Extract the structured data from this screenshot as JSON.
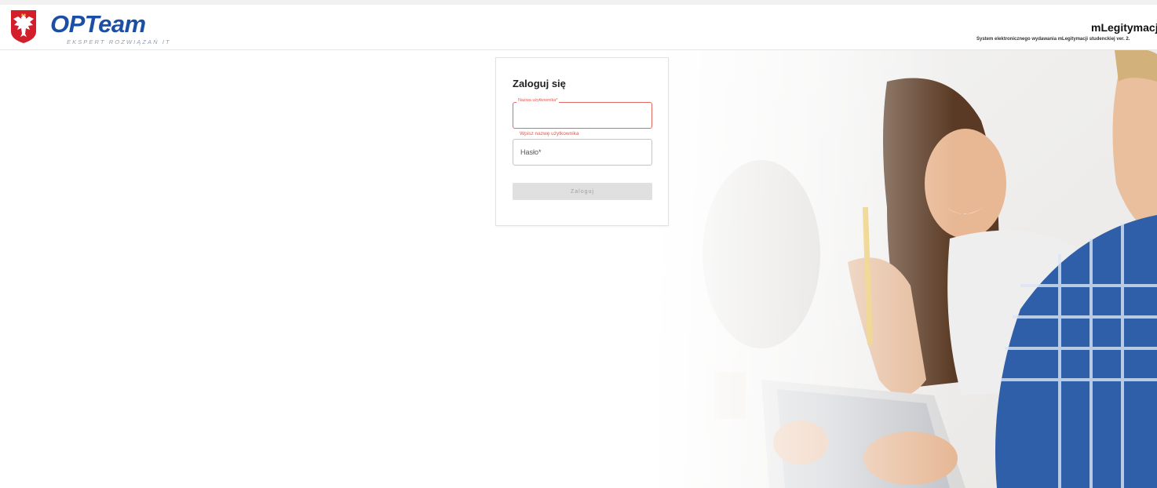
{
  "header": {
    "brand_name": "OPTeam",
    "brand_tagline": "EKSPERT ROZWIĄZAŃ IT",
    "app_title": "mLegitymacja",
    "app_subtitle": "System elektronicznego wydawania mLegitymacji studenckiej ver. 2."
  },
  "login": {
    "title": "Zaloguj się",
    "username_label": "Nazwa użytkownika*",
    "username_value": "",
    "username_error": "Wpisz nazwę użytkownika",
    "password_placeholder": "Hasło*",
    "submit_label": "Zaloguj"
  },
  "colors": {
    "brand_blue": "#1b4fa3",
    "error_red": "#e05a52",
    "disabled_button": "#e0e0e0"
  },
  "icons": {
    "emblem": "polish-eagle-emblem-icon"
  }
}
